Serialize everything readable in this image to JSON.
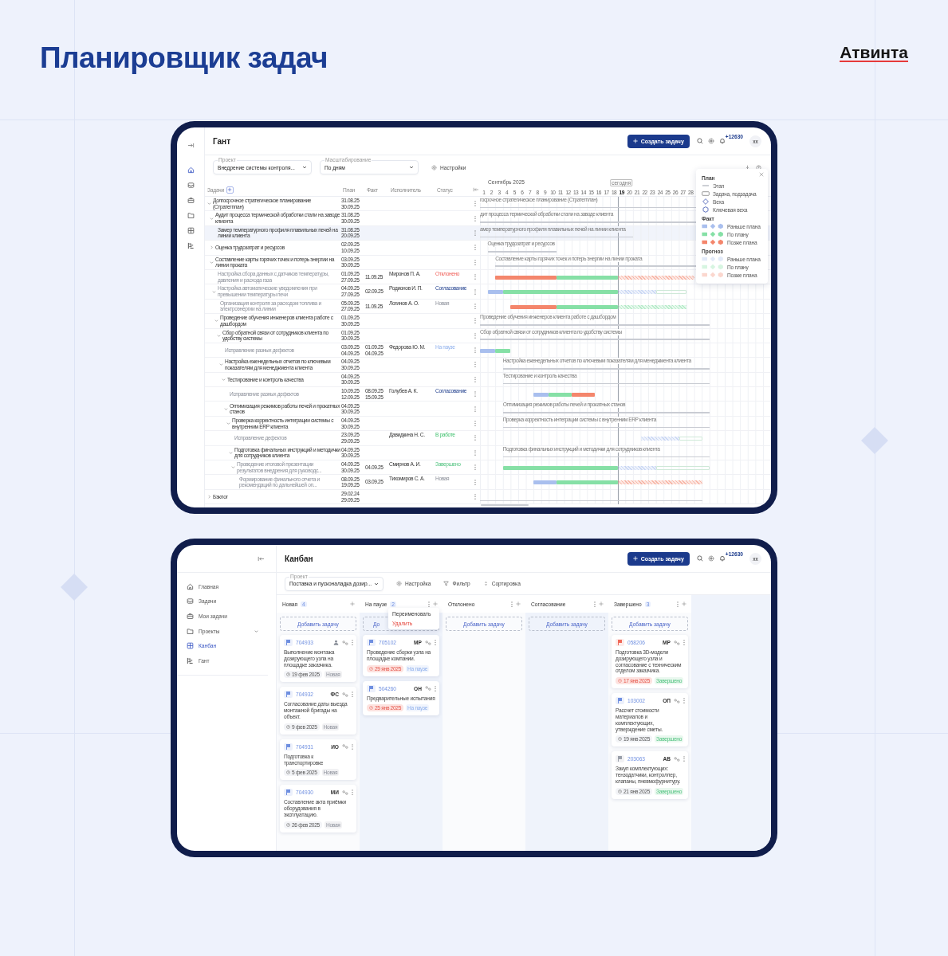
{
  "title": "Планировщик задач",
  "logo": "Атвинта",
  "gantt": {
    "header": {
      "title": "Гант",
      "create_label": "Создать задачу",
      "notifications": "+12630",
      "avatar": "xx"
    },
    "rail": [
      {
        "selected": true
      },
      {
        "selected": false
      },
      {
        "selected": false
      },
      {
        "selected": false
      },
      {
        "selected": false
      },
      {
        "selected": false
      }
    ],
    "toolbar": {
      "project": {
        "label": "Проект",
        "value": "Внедрение системы контроля..."
      },
      "scale": {
        "label": "Масштабирование",
        "value": "По дням"
      },
      "settings": "Настройки"
    },
    "columns": [
      "Задачи",
      "План",
      "Факт",
      "Исполнитель",
      "Статус"
    ],
    "timeline": {
      "month": "Сентябрь 2025",
      "today_label": "сегодня",
      "days": [
        {
          "label": "1",
          "today": false
        },
        {
          "label": "2",
          "today": false
        },
        {
          "label": "3",
          "today": false
        },
        {
          "label": "4",
          "today": false
        },
        {
          "label": "5",
          "today": false
        },
        {
          "label": "6",
          "today": false
        },
        {
          "label": "7",
          "today": false
        },
        {
          "label": "8",
          "today": false
        },
        {
          "label": "9",
          "today": false
        },
        {
          "label": "10",
          "today": false
        },
        {
          "label": "11",
          "today": false
        },
        {
          "label": "12",
          "today": false
        },
        {
          "label": "13",
          "today": false
        },
        {
          "label": "14",
          "today": false
        },
        {
          "label": "15",
          "today": false
        },
        {
          "label": "16",
          "today": false
        },
        {
          "label": "17",
          "today": false
        },
        {
          "label": "18",
          "today": false
        },
        {
          "label": "19",
          "today": true
        },
        {
          "label": "20",
          "today": false
        },
        {
          "label": "21",
          "today": false
        },
        {
          "label": "22",
          "today": false
        },
        {
          "label": "23",
          "today": false
        },
        {
          "label": "24",
          "today": false
        },
        {
          "label": "25",
          "today": false
        },
        {
          "label": "26",
          "today": false
        },
        {
          "label": "27",
          "today": false
        },
        {
          "label": "28",
          "today": false
        }
      ]
    },
    "rows": [
      {
        "name": "Долгосрочное стратегическое планирование (Стратегплан)",
        "kind": "stage",
        "expanded": true,
        "selected": false,
        "plan": [
          "31.08.25",
          "30.09.25"
        ],
        "bar_label": "госрочное стратегическое планирование (Стратегплан)",
        "children": [
          {
            "name": "Аудит процесса термической обработки стали на заводе клиента",
            "kind": "stage",
            "expanded": true,
            "selected": false,
            "plan": [
              "31.08.25",
              "30.09.25"
            ],
            "bar_label": "дит процесса термической обработки стали на заводе клиента",
            "children": [
              {
                "name": "Замер температурного профиля плавильных печей на линии клиента",
                "kind": "stage",
                "selected": true,
                "plan": [
                  "31.08.25",
                  "20.09.25"
                ],
                "bar_label": "амер температурного профиля плавильных печей на линии клиента"
              }
            ]
          },
          {
            "name": "Оценка трудозатрат и ресурсов",
            "kind": "stage",
            "expanded": false,
            "selected": false,
            "plan": [
              "02.09.25",
              "10.09.25"
            ],
            "bar_label": "Оценка трудозатрат и ресурсов"
          },
          {
            "name": "Составление карты горячих точек и потерь энергии на линии проката",
            "kind": "stage",
            "expanded": true,
            "selected": false,
            "plan": [
              "03.09.25",
              "30.09.25"
            ],
            "bar_label": "Составление карты горячих точек и потерь энергии на линии проката",
            "children": [
              {
                "name": "Настройка сбора данных с датчиков температуры, давления и расхода газа",
                "kind": "task",
                "selected": false,
                "plan": [
                  "01.09.25",
                  "27.09.25"
                ],
                "fact": [
                  "11.09.25"
                ],
                "assignee": "Миронов П. А.",
                "status": {
                  "label": "Отклонено",
                  "kind": "rejected"
                },
                "segments": [
                  {
                    "kind": "fact_late"
                  },
                  {
                    "kind": "fact_on_plan"
                  },
                  {
                    "kind": "forecast_late"
                  }
                ]
              },
              {
                "name": "Настройка автоматические уведомления при превышении температуры печи",
                "kind": "task",
                "expanded": true,
                "selected": false,
                "plan": [
                  "04.09.25",
                  "27.09.25"
                ],
                "fact": [
                  "02.09.25"
                ],
                "assignee": "Родионов И. П.",
                "status": {
                  "label": "Согласование",
                  "kind": "approval"
                },
                "segments": [
                  {
                    "kind": "fact_early"
                  },
                  {
                    "kind": "fact_on_plan"
                  },
                  {
                    "kind": "forecast_early"
                  },
                  {
                    "kind": "plan"
                  }
                ],
                "children": [
                  {
                    "name": "Организация контроля за расходом топлива и электроэнергии на линии",
                    "kind": "task",
                    "selected": false,
                    "plan": [
                      "05.09.25",
                      "27.09.25"
                    ],
                    "fact": [
                      "11.09.25"
                    ],
                    "assignee": "Логинов А. О.",
                    "status": {
                      "label": "Новая",
                      "kind": "new"
                    },
                    "segments": [
                      {
                        "kind": "fact_late"
                      },
                      {
                        "kind": "fact_on_plan"
                      },
                      {
                        "kind": "forecast_on_plan"
                      }
                    ]
                  },
                  {
                    "name": "Проведение обучения инженеров клиента работе с дашбордом",
                    "kind": "stage",
                    "expanded": true,
                    "selected": false,
                    "plan": [
                      "01.09.25",
                      "30.09.25"
                    ],
                    "bar_label": "Проведение обучения инженеров клиента работе с дашбордом",
                    "children": [
                      {
                        "name": "Сбор обратной связи от сотрудников клиента по удобству системы",
                        "kind": "stage",
                        "expanded": true,
                        "selected": false,
                        "plan": [
                          "01.09.25",
                          "30.09.25"
                        ],
                        "bar_label": "Сбор обратной связи от сотрудников клиента по удобству системы",
                        "children": [
                          {
                            "name": "Исправление разных дефектов",
                            "kind": "task",
                            "selected": false,
                            "plan": [
                              "03.09.25",
                              "04.09.25"
                            ],
                            "fact": [
                              "01.09.25",
                              "04.09.25"
                            ],
                            "assignee": "Федорова Ю. М.",
                            "status": {
                              "label": "На паузе",
                              "kind": "paused"
                            },
                            "segments": [
                              {
                                "kind": "fact_early"
                              },
                              {
                                "kind": "fact_on_plan"
                              }
                            ]
                          },
                          {
                            "name": "Настройка еженедельных отчетов по ключевым показателям для менеджмента клиента",
                            "kind": "stage",
                            "expanded": true,
                            "selected": false,
                            "plan": [
                              "04.09.25",
                              "30.09.25"
                            ],
                            "bar_label": "Настройка еженедельных отчетов по ключевым показателям для менеджмента клиента",
                            "children": [
                              {
                                "name": "Тестирование и контроль качества",
                                "kind": "stage",
                                "expanded": true,
                                "selected": false,
                                "plan": [
                                  "04.09.25",
                                  "30.09.25"
                                ],
                                "bar_label": "Тестирование и контроль качества",
                                "children": [
                                  {
                                    "name": "Исправление разных дефектов",
                                    "kind": "task",
                                    "selected": false,
                                    "plan": [
                                      "10.09.25",
                                      "12.09.25"
                                    ],
                                    "fact": [
                                      "08.09.25",
                                      "15.09.25"
                                    ],
                                    "assignee": "Голубев А. К.",
                                    "status": {
                                      "label": "Согласование",
                                      "kind": "approval"
                                    },
                                    "segments": [
                                      {
                                        "kind": "fact_early"
                                      },
                                      {
                                        "kind": "fact_on_plan"
                                      },
                                      {
                                        "kind": "fact_late"
                                      }
                                    ]
                                  },
                                  {
                                    "name": "Оптимизация режимов работы печей и прокатных станов",
                                    "kind": "stage",
                                    "expanded": true,
                                    "selected": false,
                                    "plan": [
                                      "04.09.25",
                                      "30.09.25"
                                    ],
                                    "bar_label": "Оптимизация режимов работы печей и прокатных станов",
                                    "children": [
                                      {
                                        "name": "Проверка корректность интеграции системы с внутренним ERP клиента",
                                        "kind": "stage",
                                        "expanded": true,
                                        "selected": false,
                                        "plan": [
                                          "04.09.25",
                                          "30.09.25"
                                        ],
                                        "bar_label": "Проверка корректность интеграции системы с внутренним ERP клиента",
                                        "children": [
                                          {
                                            "name": "Исправление дефектов",
                                            "kind": "task",
                                            "selected": false,
                                            "plan": [
                                              "23.09.25",
                                              "29.09.25"
                                            ],
                                            "assignee": "Давидкина Н. С.",
                                            "status": {
                                              "label": "В работе",
                                              "kind": "in_progress"
                                            },
                                            "segments": [
                                              {
                                                "kind": "forecast_early"
                                              },
                                              {
                                                "kind": "plan"
                                              }
                                            ]
                                          },
                                          {
                                            "name": "Подготовка финальных инструкций и методички для сотрудников клиента",
                                            "kind": "stage",
                                            "expanded": true,
                                            "selected": false,
                                            "plan": [
                                              "04.09.25",
                                              "30.09.25"
                                            ],
                                            "bar_label": "Подготовка финальных инструкций и методички для сотрудников клиента",
                                            "children": [
                                              {
                                                "name": "Проведение итоговой презентации результатов внедрения для руководс...",
                                                "kind": "task",
                                                "expanded": true,
                                                "selected": false,
                                                "plan": [
                                                  "04.09.25",
                                                  "30.09.25"
                                                ],
                                                "fact": [
                                                  "04.09.25"
                                                ],
                                                "assignee": "Смирнов А. И.",
                                                "status": {
                                                  "label": "Завершено",
                                                  "kind": "done"
                                                },
                                                "segments": [
                                                  {
                                                    "kind": "fact_on_plan"
                                                  },
                                                  {
                                                    "kind": "forecast_early"
                                                  },
                                                  {
                                                    "kind": "plan"
                                                  }
                                                ],
                                                "children": [
                                                  {
                                                    "name": "Формирование финального отчета и рекомендаций по дальнейшей оп...",
                                                    "kind": "task",
                                                    "selected": false,
                                                    "plan": [
                                                      "08.09.25",
                                                      "19.09.25"
                                                    ],
                                                    "fact": [
                                                      "03.09.25"
                                                    ],
                                                    "assignee": "Тихомиров С. А.",
                                                    "status": {
                                                      "label": "Новая",
                                                      "kind": "new"
                                                    },
                                                    "segments": [
                                                      {
                                                        "kind": "fact_early"
                                                      },
                                                      {
                                                        "kind": "fact_on_plan"
                                                      },
                                                      {
                                                        "kind": "forecast_late"
                                                      }
                                                    ]
                                                  }
                                                ]
                                              }
                                            ]
                                          }
                                        ]
                                      }
                                    ]
                                  }
                                ]
                              }
                            ]
                          }
                        ]
                      }
                    ]
                  }
                ]
              }
            ]
          }
        ]
      },
      {
        "name": "Бэклог",
        "kind": "stage",
        "expanded": false,
        "selected": false,
        "plan": [
          "29.02.24",
          "29.09.25"
        ]
      }
    ],
    "legend": {
      "plan_title": "План",
      "plan_items": [
        {
          "kind": "stage",
          "label": "Этап"
        },
        {
          "kind": "task",
          "label": "Задача, подзадача"
        },
        {
          "kind": "milestone",
          "label": "Веха"
        },
        {
          "kind": "key_milestone",
          "label": "Ключевая веха"
        }
      ],
      "groups": [
        {
          "title": "Факт",
          "kind": "fact",
          "items": [
            {
              "kind": "early",
              "label": "Раньше плана"
            },
            {
              "kind": "on_plan",
              "label": "По плану"
            },
            {
              "kind": "late",
              "label": "Позже плана"
            }
          ]
        },
        {
          "title": "Прогноз",
          "kind": "forecast",
          "items": [
            {
              "kind": "early",
              "label": "Раньше плана"
            },
            {
              "kind": "on_plan",
              "label": "По плану"
            },
            {
              "kind": "late",
              "label": "Позже плана"
            }
          ]
        }
      ]
    }
  },
  "kanban": {
    "header": {
      "title": "Канбан",
      "create_label": "Создать задачу",
      "notifications": "+12630",
      "avatar": "xx"
    },
    "sidebar": [
      {
        "label": "Главная",
        "selected": false
      },
      {
        "label": "Задачи",
        "selected": false
      },
      {
        "label": "Мои задачи",
        "selected": false
      },
      {
        "label": "Проекты",
        "selected": false,
        "expanded": false
      },
      {
        "label": "Канбан",
        "selected": true
      },
      {
        "label": "Гант",
        "selected": false
      }
    ],
    "toolbar": {
      "project": {
        "label": "Проект",
        "value": "Поставка и пусконаладка дозир..."
      },
      "actions": [
        "Настройка",
        "Фильтр",
        "Сортировка"
      ]
    },
    "columns": [
      {
        "title": "Новая",
        "count": "4",
        "add_label": "Добавить задачу",
        "cards": [
          {
            "id": "704933",
            "color": "#6f8fe0",
            "title": "Выполнение монтажа дозирующего узла на площадке заказчика.",
            "date": "19 фев 2025",
            "overdue": false,
            "status": {
              "label": "Новая",
              "kind": "new"
            }
          },
          {
            "id": "704932",
            "initials": "ФС",
            "color": "#6f8fe0",
            "title": "Согласование даты выезда монтажной бригады на объект.",
            "date": "9 фев 2025",
            "overdue": false,
            "status": {
              "label": "Новая",
              "kind": "new"
            }
          },
          {
            "id": "704931",
            "initials": "ИО",
            "color": "#6f8fe0",
            "title": "Подготовка к транспортировке",
            "date": "5 фев 2025",
            "overdue": false,
            "status": {
              "label": "Новая",
              "kind": "new"
            }
          },
          {
            "id": "704930",
            "initials": "МИ",
            "color": "#6f8fe0",
            "title": "Составление акта приёмки оборудования в эксплуатацию.",
            "date": "26 фев 2025",
            "overdue": false,
            "status": {
              "label": "Новая",
              "kind": "new"
            }
          }
        ]
      },
      {
        "title": "На паузе",
        "count": "2",
        "add_label": "До",
        "menu": [
          {
            "kind": "normal",
            "label": "Переименовать"
          },
          {
            "kind": "danger",
            "label": "Удалить"
          }
        ],
        "cards": [
          {
            "id": "705102",
            "initials": "МР",
            "color": "#6f8fe0",
            "title": "Проведение сборки узла на площадке компании.",
            "date": "29 янв 2025",
            "overdue": true,
            "status": {
              "label": "На паузе",
              "kind": "paused"
            }
          },
          {
            "id": "504260",
            "initials": "ОН",
            "color": "#6f8fe0",
            "title": "Предварительные испытания",
            "date": "25 янв 2025",
            "overdue": true,
            "status": {
              "label": "На паузе",
              "kind": "paused"
            }
          }
        ]
      },
      {
        "title": "Отклонено",
        "add_label": "Добавить задачу"
      },
      {
        "title": "Согласование",
        "add_label": "Добавить задачу"
      },
      {
        "title": "Завершено",
        "count": "3",
        "add_label": "Добавить задачу",
        "cards": [
          {
            "id": "058206",
            "initials": "МР",
            "color": "#f06a5a",
            "title": "Подготовка 3D-модели дозирующего узла и согласование с техническим отделом заказчика.",
            "date": "17 янв 2025",
            "overdue": true,
            "status": {
              "label": "Завершено",
              "kind": "done"
            }
          },
          {
            "id": "103002",
            "initials": "ОП",
            "color": "#6f8fe0",
            "title": "Рассчет стоимости материалов и комплектующих, утверждение сметы.",
            "date": "19 янв 2025",
            "overdue": false,
            "status": {
              "label": "Завершено",
              "kind": "done"
            }
          },
          {
            "id": "203063",
            "initials": "АВ",
            "color": "#9aa0aa",
            "title": "Закуп комплектующих: тензодатчики, контроллер, клапаны, пневмофурнитуру.",
            "date": "21 янв 2025",
            "overdue": false,
            "status": {
              "label": "Завершено",
              "kind": "done"
            }
          }
        ]
      }
    ]
  }
}
